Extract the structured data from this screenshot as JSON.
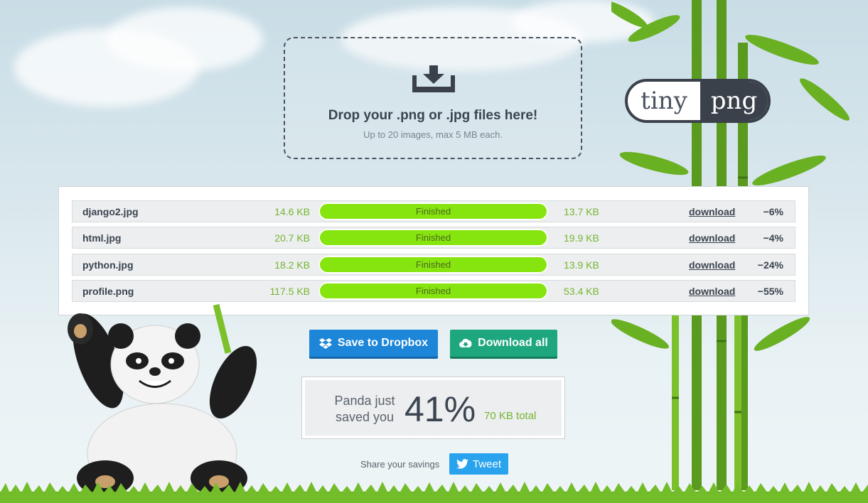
{
  "dropzone": {
    "title": "Drop your .png or .jpg files here!",
    "subtitle": "Up to 20 images, max 5 MB each.",
    "icon": "download-tray-icon"
  },
  "logo": {
    "left": "tiny",
    "right": "png"
  },
  "files": [
    {
      "name": "django2.jpg",
      "original_size": "14.6 KB",
      "status": "Finished",
      "new_size": "13.7 KB",
      "download_label": "download",
      "saving": "−6%"
    },
    {
      "name": "html.jpg",
      "original_size": "20.7 KB",
      "status": "Finished",
      "new_size": "19.9 KB",
      "download_label": "download",
      "saving": "−4%"
    },
    {
      "name": "python.jpg",
      "original_size": "18.2 KB",
      "status": "Finished",
      "new_size": "13.9 KB",
      "download_label": "download",
      "saving": "−24%"
    },
    {
      "name": "profile.png",
      "original_size": "117.5 KB",
      "status": "Finished",
      "new_size": "53.4 KB",
      "download_label": "download",
      "saving": "−55%"
    }
  ],
  "actions": {
    "dropbox_label": "Save to Dropbox",
    "download_all_label": "Download all"
  },
  "savings": {
    "label_line1": "Panda just",
    "label_line2": "saved you",
    "percent": "41%",
    "total": "70 KB total"
  },
  "share": {
    "label": "Share your savings",
    "tweet_label": "Tweet"
  },
  "colors": {
    "progress": "#86e40f",
    "dropbox": "#1d86d9",
    "download_all": "#1ea77e",
    "tweet": "#2aa3ef",
    "size_text": "#76b531"
  }
}
